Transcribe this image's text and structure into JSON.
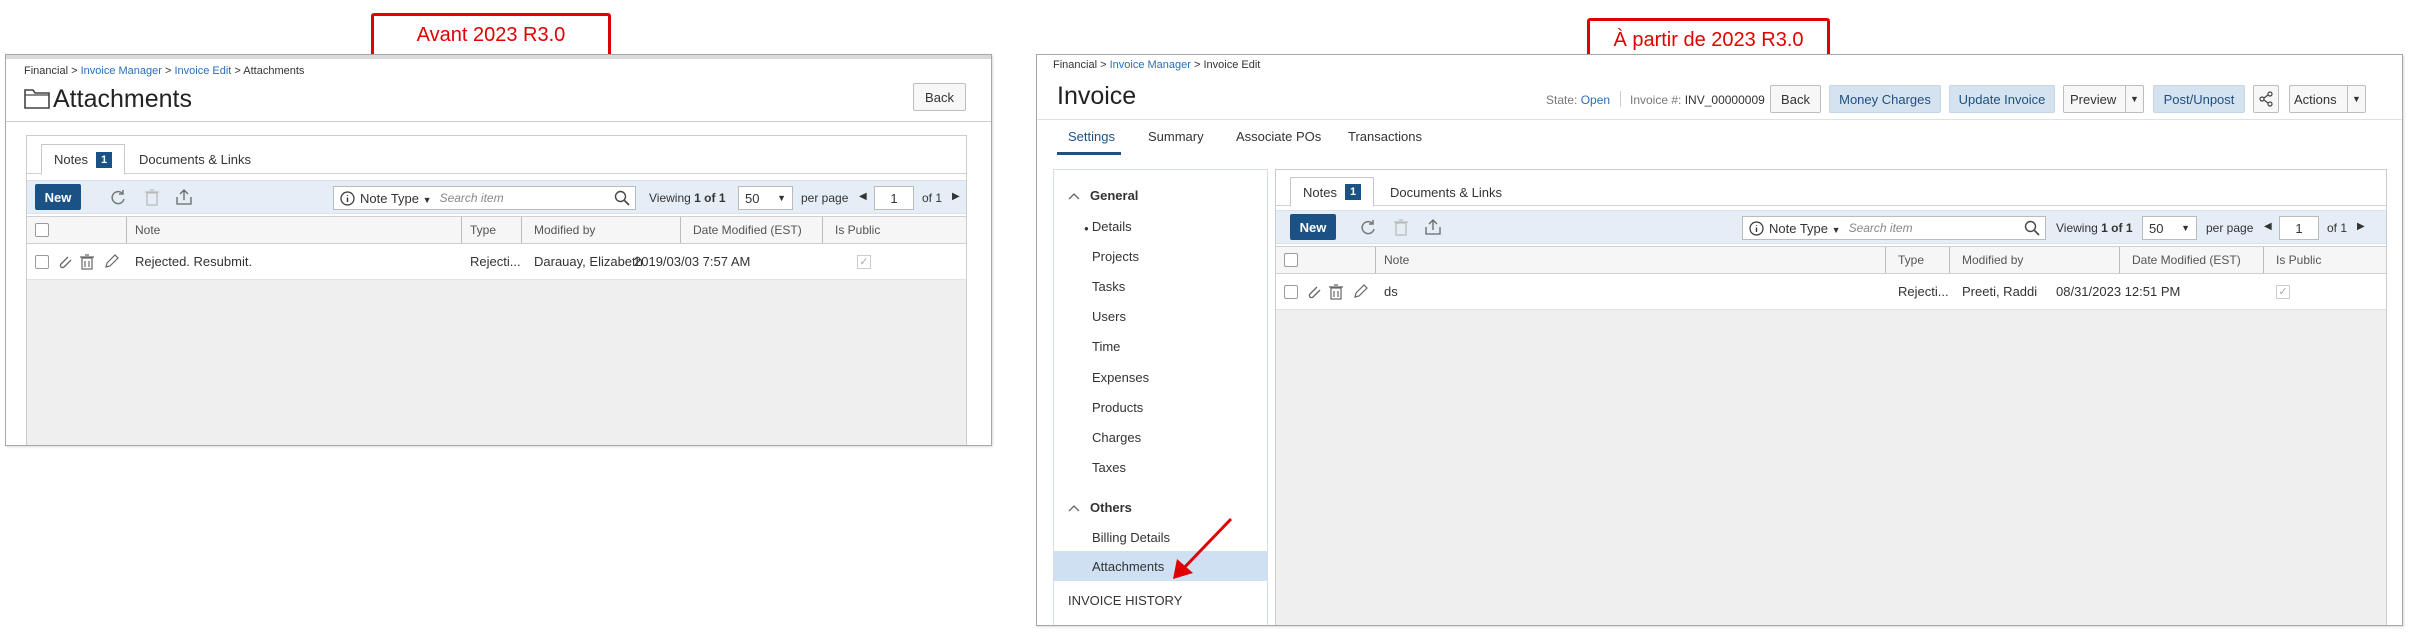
{
  "callouts": {
    "left": "Avant 2023 R3.0",
    "right": "À partir de 2023 R3.0"
  },
  "old_ui": {
    "breadcrumb": {
      "part1": "Financial",
      "sep": " > ",
      "part2": "Invoice Manager",
      "part3": "Invoice Edit",
      "part4": "Attachments"
    },
    "title": "Attachments",
    "back_label": "Back",
    "tabs": {
      "notes": "Notes",
      "notes_count": "1",
      "docs": "Documents & Links"
    },
    "toolbar": {
      "new_label": "New",
      "note_type": "Note Type",
      "search_placeholder": "Search item",
      "viewing_label": "Viewing",
      "viewing_range": "1 of 1",
      "per_page_value": "50",
      "per_page_label": "per page",
      "page_value": "1",
      "of_pages": "of 1"
    },
    "columns": {
      "note": "Note",
      "type": "Type",
      "modified_by": "Modified by",
      "date_modified": "Date Modified (EST)",
      "is_public": "Is Public"
    },
    "rows": [
      {
        "note": "Rejected. Resubmit.",
        "type": "Rejecti...",
        "modified_by": "Darauay, Elizabeth",
        "date": "2019/03/03 7:57 AM"
      }
    ]
  },
  "new_ui": {
    "breadcrumb": {
      "part1": "Financial",
      "part2": "Invoice Manager",
      "part3": "Invoice Edit"
    },
    "title": "Invoice",
    "state_label": "State:",
    "state_value": "Open",
    "invoice_label": "Invoice #:",
    "invoice_value": "INV_00000009",
    "buttons": {
      "back": "Back",
      "money_charges": "Money Charges",
      "update_invoice": "Update Invoice",
      "preview": "Preview",
      "post_unpost": "Post/Unpost",
      "actions": "Actions"
    },
    "main_tabs": [
      "Settings",
      "Summary",
      "Associate POs",
      "Transactions"
    ],
    "sidebar": {
      "general": "General",
      "general_items": [
        "Details",
        "Projects",
        "Tasks",
        "Users",
        "Time",
        "Expenses",
        "Products",
        "Charges",
        "Taxes"
      ],
      "others": "Others",
      "others_items": [
        "Billing Details",
        "Attachments"
      ],
      "history": "INVOICE HISTORY"
    },
    "tabs": {
      "notes": "Notes",
      "notes_count": "1",
      "docs": "Documents & Links"
    },
    "toolbar": {
      "new_label": "New",
      "note_type": "Note Type",
      "search_placeholder": "Search item",
      "viewing_label": "Viewing",
      "viewing_range": "1 of 1",
      "per_page_value": "50",
      "per_page_label": "per page",
      "page_value": "1",
      "of_pages": "of 1"
    },
    "columns": {
      "note": "Note",
      "type": "Type",
      "modified_by": "Modified by",
      "date_modified": "Date Modified (EST)",
      "is_public": "Is Public"
    },
    "rows": [
      {
        "note": "ds",
        "type": "Rejecti...",
        "modified_by": "Preeti, Raddi",
        "date": "08/31/2023 12:51 PM"
      }
    ]
  },
  "colors": {
    "accent": "#1b5286",
    "callout": "#e00000",
    "link": "#2a6ebb",
    "selected_bg": "#cfe0f3"
  }
}
